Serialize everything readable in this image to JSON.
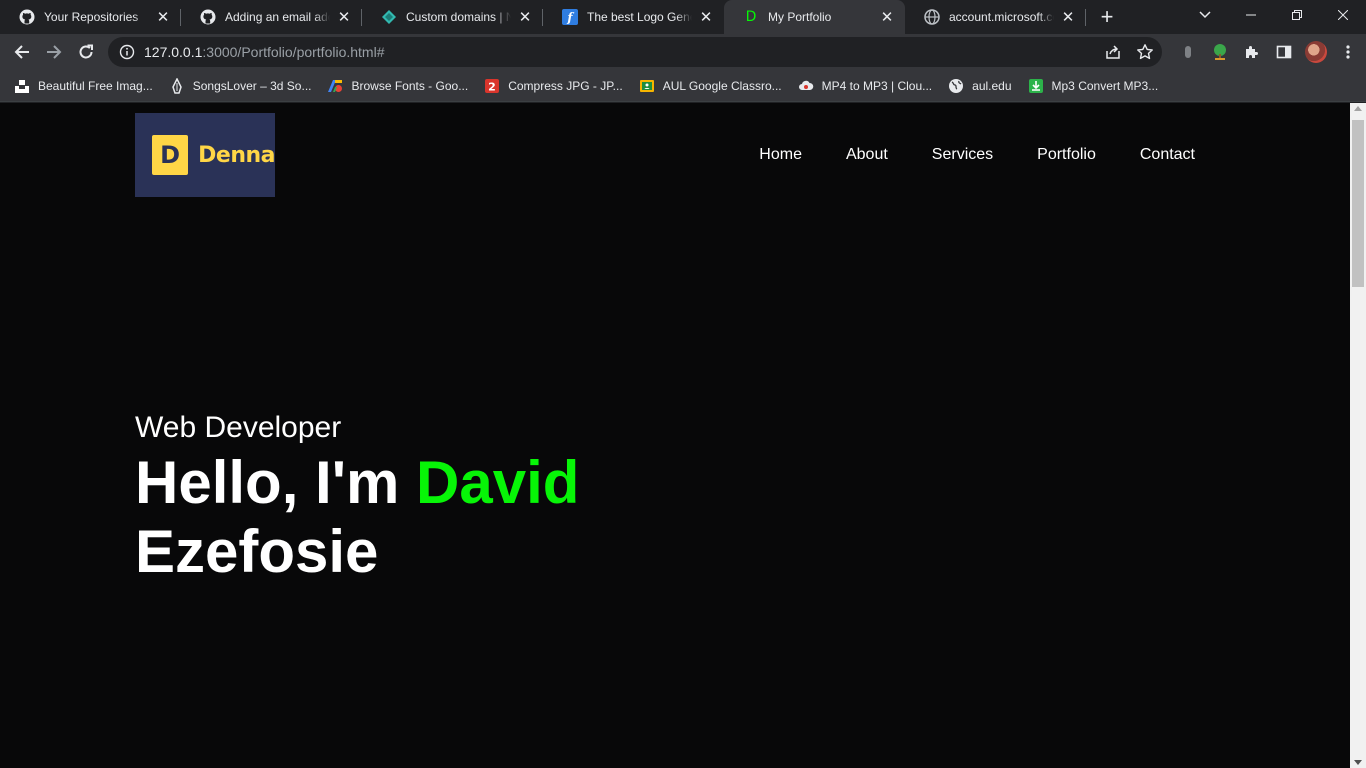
{
  "browser": {
    "tabs": [
      {
        "title": "Your Repositories",
        "icon": "github-icon",
        "active": false
      },
      {
        "title": "Adding an email address",
        "icon": "github-icon",
        "active": false
      },
      {
        "title": "Custom domains | Netlify",
        "icon": "netlify-icon",
        "active": false
      },
      {
        "title": "The best Logo Generator",
        "icon": "logo-generator-icon",
        "active": false
      },
      {
        "title": "My Portfolio",
        "icon": "portfolio-d-icon",
        "active": true
      },
      {
        "title": "account.microsoft.com",
        "icon": "globe-icon",
        "active": false
      }
    ],
    "new_tab": "+",
    "url": {
      "host": "127.0.0.1",
      "path": ":3000/Portfolio/portfolio.html#"
    },
    "bookmarks": [
      {
        "label": "Beautiful Free Imag...",
        "icon": "unsplash-icon"
      },
      {
        "label": "SongsLover – 3d So...",
        "icon": "songslover-icon"
      },
      {
        "label": "Browse Fonts - Goo...",
        "icon": "google-fonts-icon"
      },
      {
        "label": "Compress JPG - JP...",
        "icon": "compress-jpg-icon"
      },
      {
        "label": "AUL Google Classro...",
        "icon": "google-classroom-icon"
      },
      {
        "label": "MP4 to MP3 | Clou...",
        "icon": "cloudconvert-icon"
      },
      {
        "label": "aul.edu",
        "icon": "globe-icon"
      },
      {
        "label": "Mp3 Convert MP3...",
        "icon": "download-icon"
      }
    ]
  },
  "site": {
    "logo": {
      "mark": "D",
      "brand": "Denna"
    },
    "nav": [
      "Home",
      "About",
      "Services",
      "Portfolio",
      "Contact"
    ],
    "hero": {
      "role": "Web Developer",
      "greeting": "Hello, I'm",
      "first_name": "David",
      "last_name": "Ezefosie"
    }
  },
  "colors": {
    "accent": "#07f507",
    "logo_bg": "#2a3257",
    "logo_yellow": "#ffd646",
    "page_bg": "#080809"
  }
}
